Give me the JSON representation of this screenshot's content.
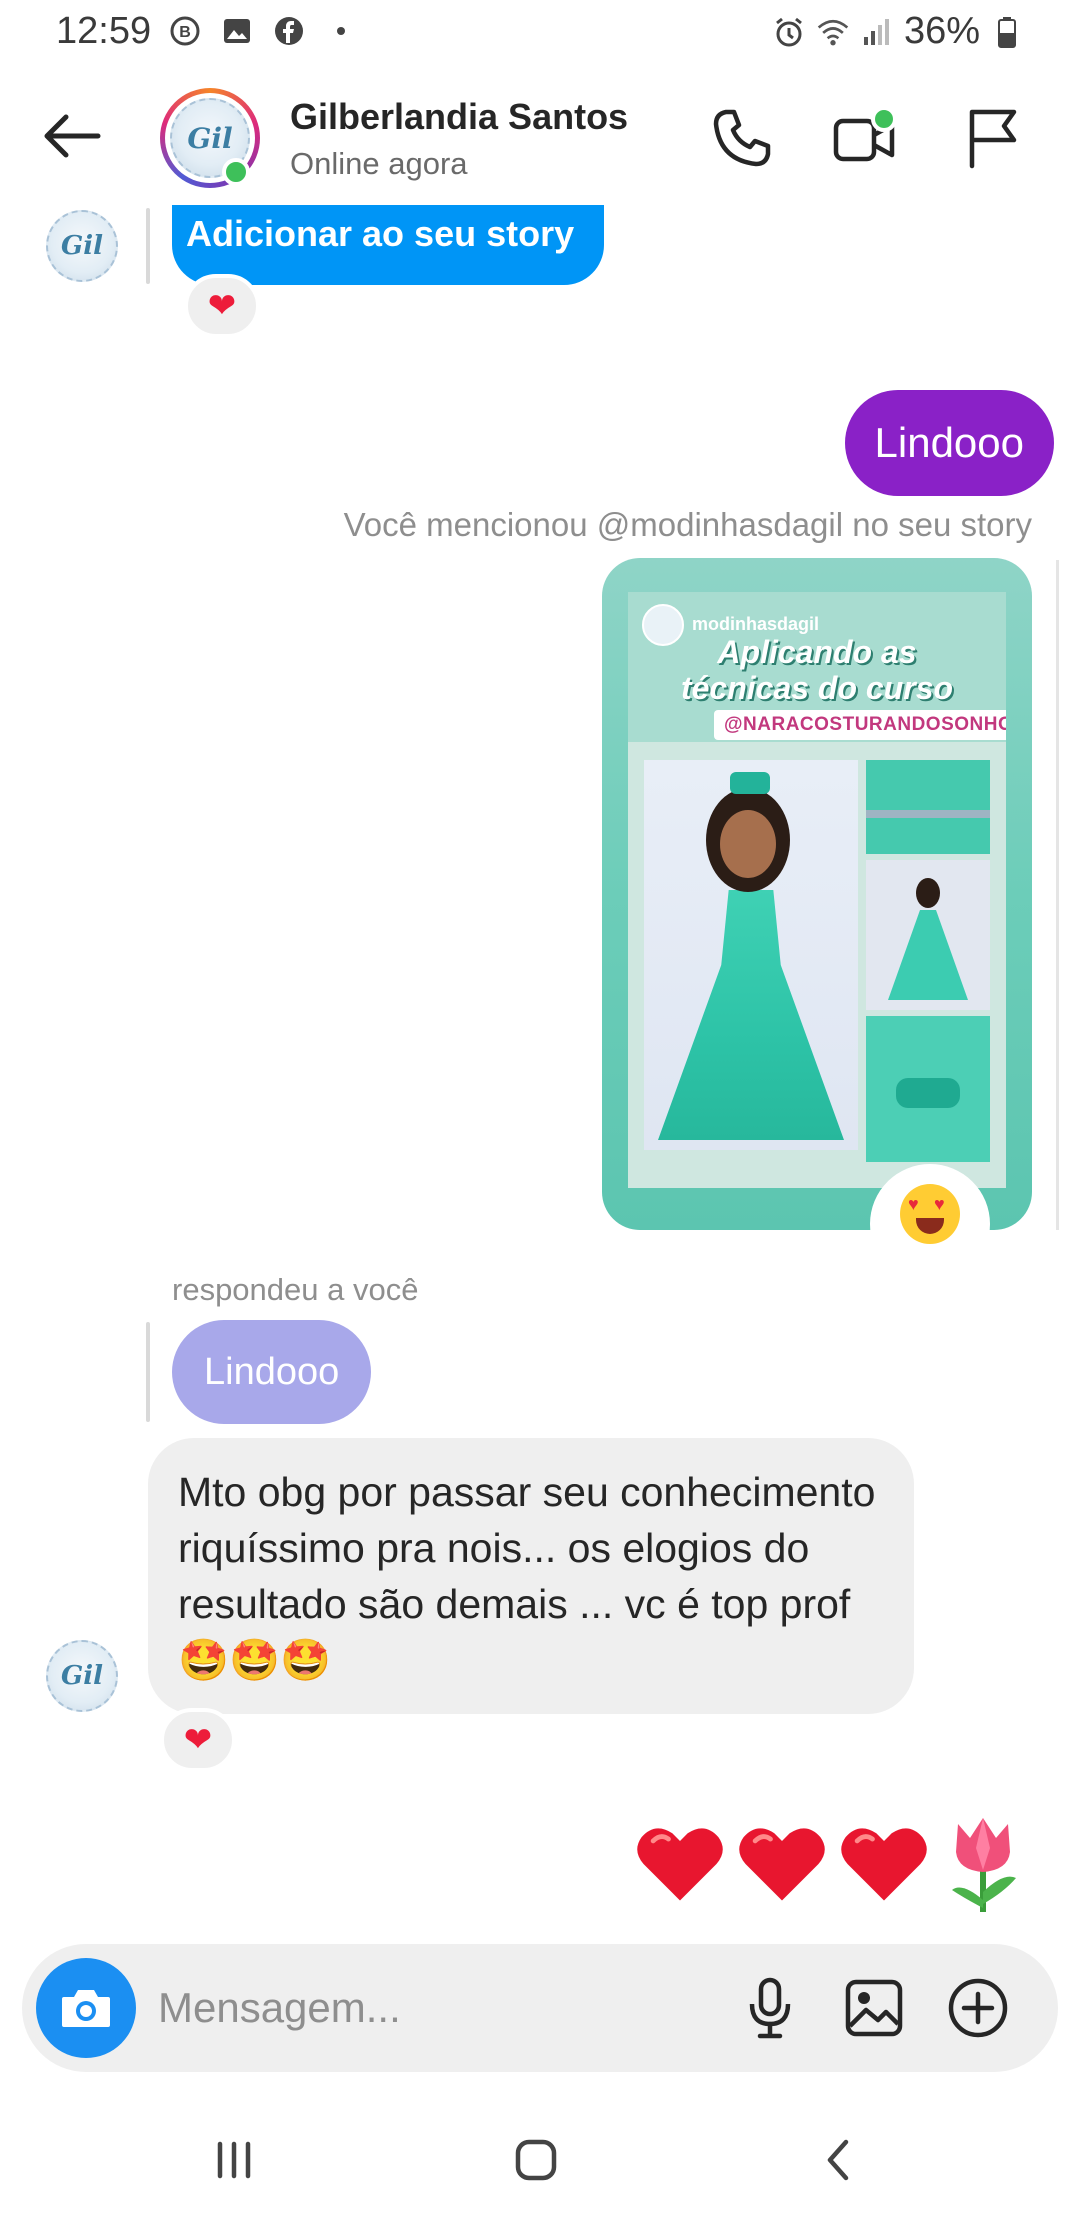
{
  "status_bar": {
    "time": "12:59",
    "battery": "36%"
  },
  "header": {
    "contact_name": "Gilberlandia Santos",
    "contact_status": "Online agora",
    "avatar_text": "Gil"
  },
  "messages": {
    "story_bubble": "Adicionar ao seu story",
    "story_reaction": "❤",
    "sent_text": "Lindooo",
    "mention_text": "Você mencionou @modinhasdagil no seu story",
    "story_card": {
      "username": "modinhasdagil",
      "title_line1": "Aplicando as",
      "title_line2": "técnicas do curso",
      "tag": "@NARACOSTURANDOSONHOS"
    },
    "replied_label": "respondeu a você",
    "quoted_text": "Lindooo",
    "received_text": "Mto obg por passar seu conhecimento riquíssimo pra nois... os elogios do resultado são demais ... vc é top prof🤩🤩🤩",
    "received_reaction": "❤",
    "emoji_message": "❤️❤️❤️🌷"
  },
  "composer": {
    "placeholder": "Mensagem..."
  },
  "colors": {
    "accent_blue": "#0095f6",
    "sent_purple": "#8a21c7",
    "quoted_lavender": "#a8a8ea",
    "online_green": "#3ec05a",
    "camera_blue": "#1b8ff2"
  }
}
